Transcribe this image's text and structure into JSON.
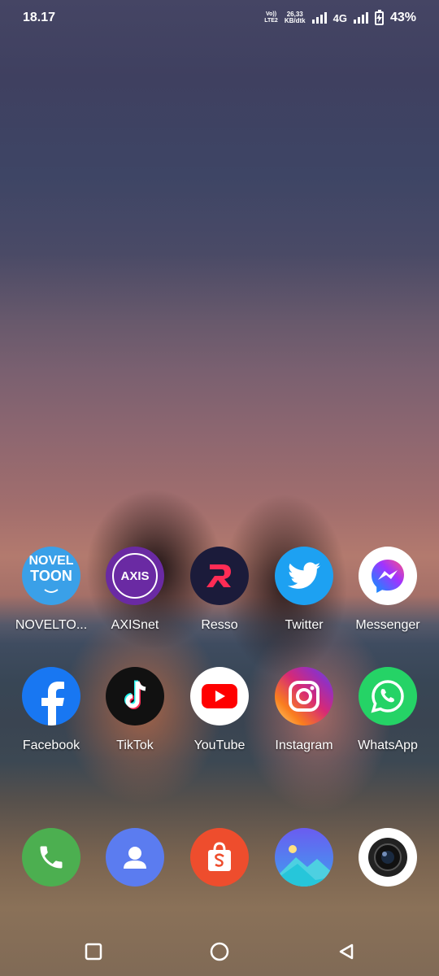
{
  "status": {
    "time": "18.17",
    "volte_top": "Vo))",
    "volte_bottom": "LTE2",
    "speed_value": "26,33",
    "speed_unit": "KB/dtk",
    "network": "4G",
    "battery": "43%"
  },
  "apps_row1": [
    {
      "label": "NOVELTO...",
      "icon": "noveltoon-icon",
      "color": "#3aa0e8",
      "icon_text_1": "NOVEL",
      "icon_text_2": "TOON"
    },
    {
      "label": "AXISnet",
      "icon": "axis-icon",
      "color": "#6a2aa3",
      "icon_text_1": "AXIS"
    },
    {
      "label": "Resso",
      "icon": "resso-icon",
      "color": "#1b1b3a"
    },
    {
      "label": "Twitter",
      "icon": "twitter-bird-icon",
      "color": "#1da1f2"
    },
    {
      "label": "Messenger",
      "icon": "messenger-icon",
      "color": "#ffffff"
    }
  ],
  "apps_row2": [
    {
      "label": "Facebook",
      "icon": "facebook-icon",
      "color": "#1877f2"
    },
    {
      "label": "TikTok",
      "icon": "tiktok-icon",
      "color": "#111111"
    },
    {
      "label": "YouTube",
      "icon": "youtube-icon",
      "color": "#ffffff"
    },
    {
      "label": "Instagram",
      "icon": "instagram-icon",
      "color": "#d6249f"
    },
    {
      "label": "WhatsApp",
      "icon": "whatsapp-icon",
      "color": "#25d366"
    }
  ],
  "dock": [
    {
      "icon": "phone-icon",
      "color": "#4caf50"
    },
    {
      "icon": "contacts-icon",
      "color": "#5b7cf0"
    },
    {
      "icon": "shopee-icon",
      "color": "#ee4d2d"
    },
    {
      "icon": "gallery-icon",
      "color": "#3f8ef5"
    },
    {
      "icon": "camera-icon",
      "color": "#ffffff"
    }
  ],
  "navigation": {
    "recents": "recents-square-icon",
    "home": "home-circle-icon",
    "back": "back-triangle-icon"
  }
}
